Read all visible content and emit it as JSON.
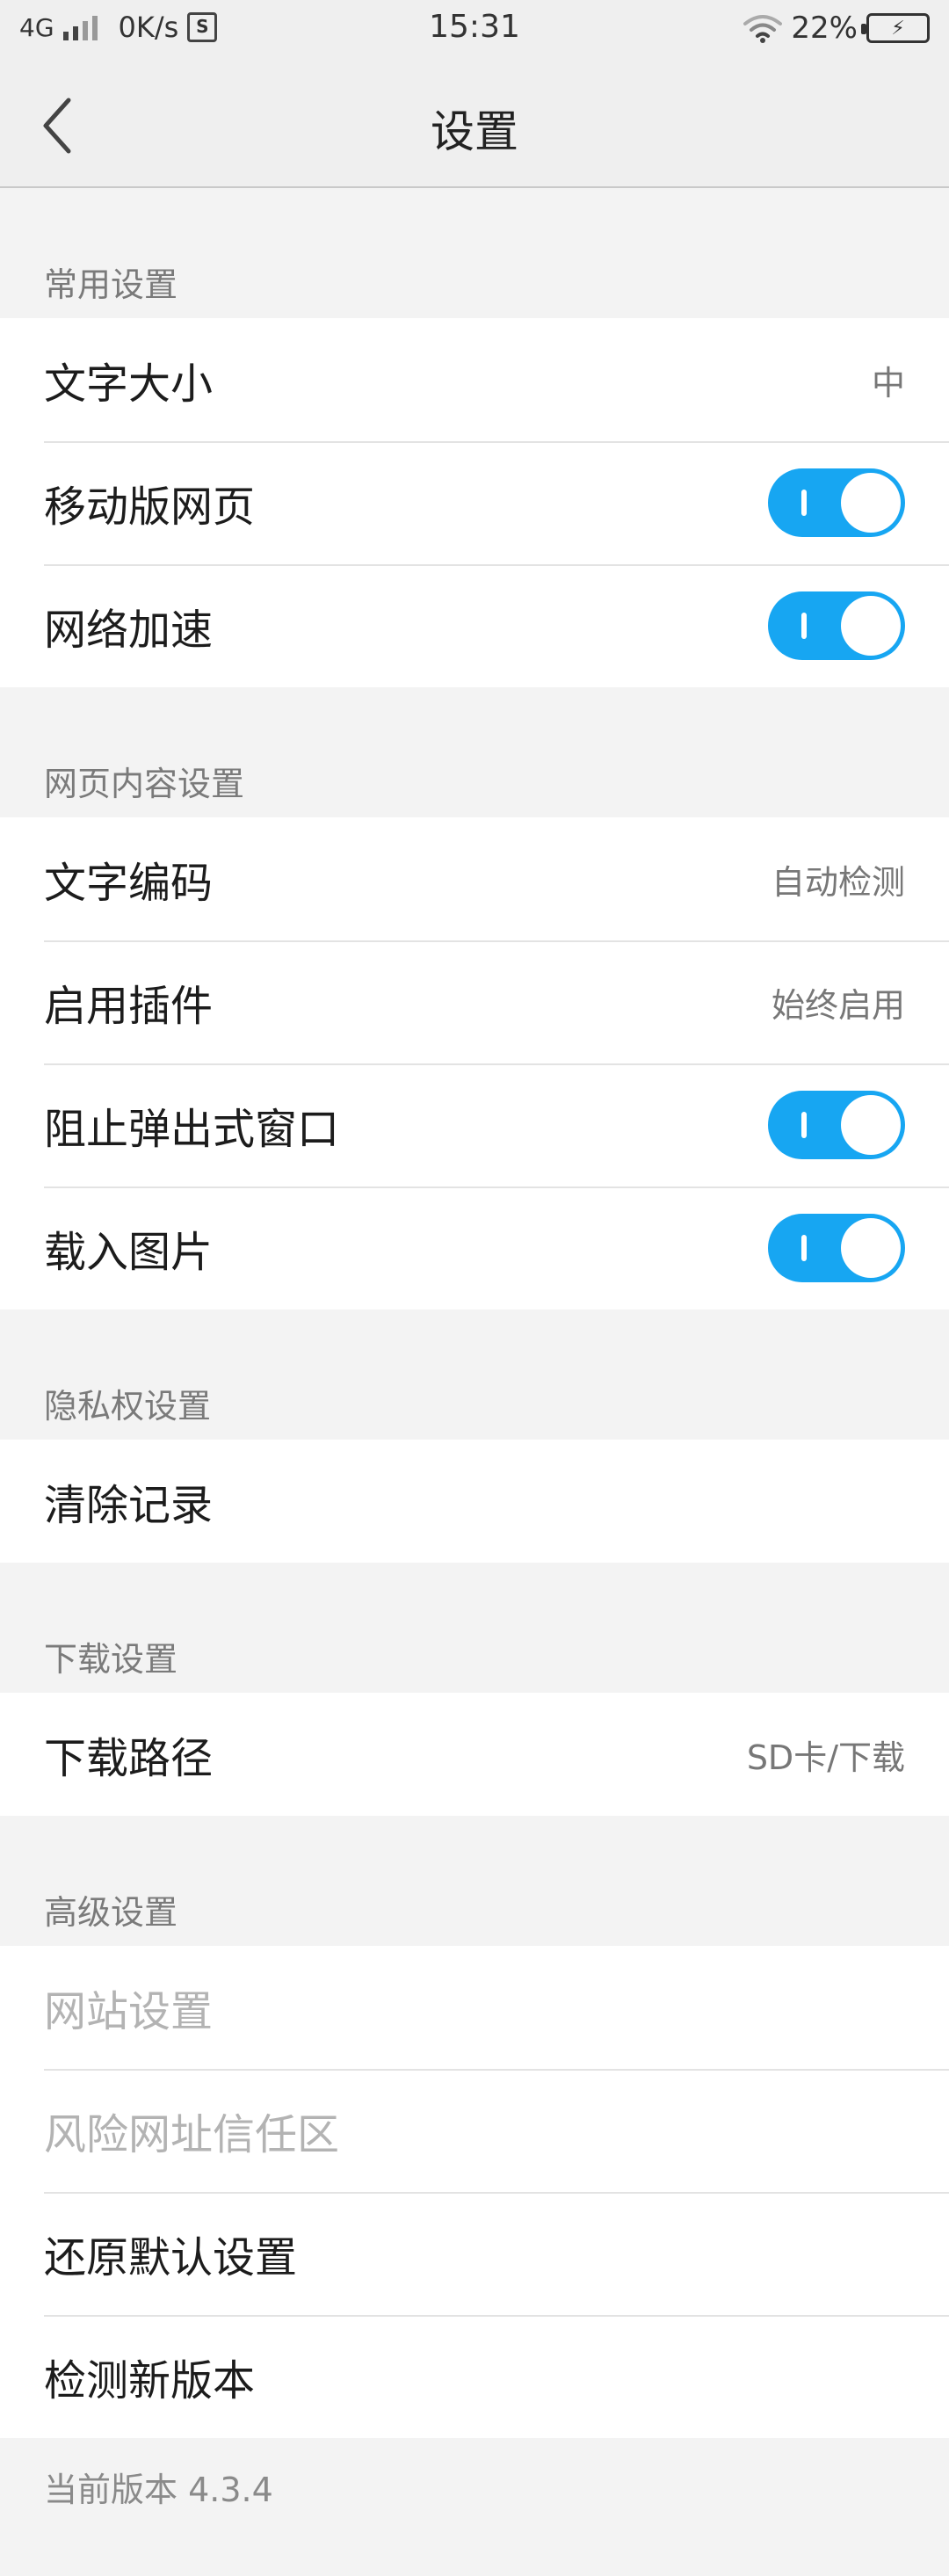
{
  "status_bar": {
    "network_type": "4G",
    "speed": "0K/s",
    "sim_icon_letter": "S",
    "time": "15:31",
    "battery_percent": "22%"
  },
  "header": {
    "title": "设置"
  },
  "sections": {
    "common": {
      "title": "常用设置",
      "text_size_label": "文字大小",
      "text_size_value": "中",
      "mobile_page_label": "移动版网页",
      "mobile_page_on": true,
      "net_accel_label": "网络加速",
      "net_accel_on": true
    },
    "web_content": {
      "title": "网页内容设置",
      "encoding_label": "文字编码",
      "encoding_value": "自动检测",
      "plugins_label": "启用插件",
      "plugins_value": "始终启用",
      "block_popups_label": "阻止弹出式窗口",
      "block_popups_on": true,
      "load_images_label": "载入图片",
      "load_images_on": true
    },
    "privacy": {
      "title": "隐私权设置",
      "clear_history_label": "清除记录"
    },
    "download": {
      "title": "下载设置",
      "path_label": "下载路径",
      "path_value": "SD卡/下载"
    },
    "advanced": {
      "title": "高级设置",
      "site_settings_label": "网站设置",
      "trust_zone_label": "风险网址信任区",
      "restore_defaults_label": "还原默认设置",
      "check_update_label": "检测新版本"
    }
  },
  "footer": {
    "version_text": "当前版本 4.3.4"
  },
  "colors": {
    "accent": "#17a6f2",
    "background": "#f3f3f3",
    "disabled_text": "#b3b3b3"
  }
}
